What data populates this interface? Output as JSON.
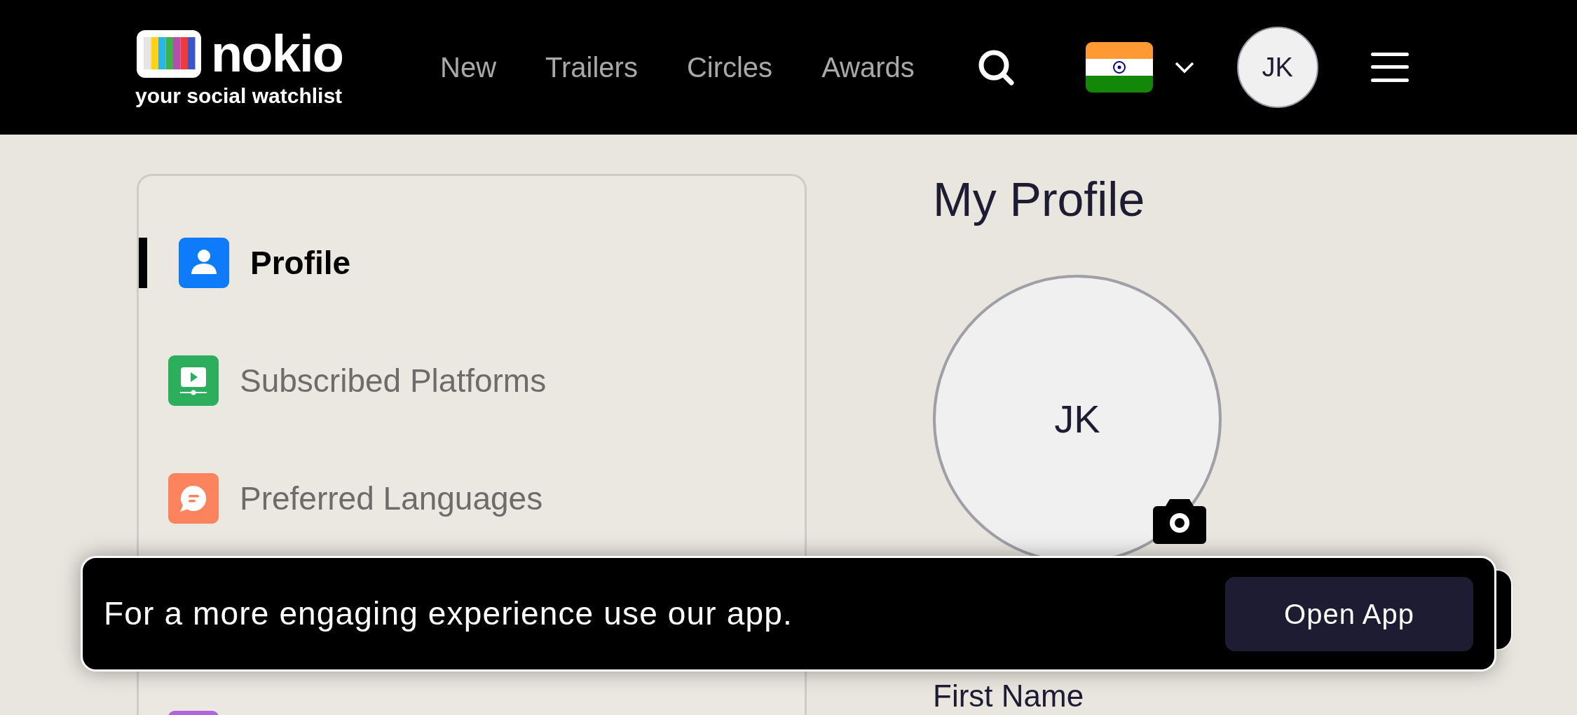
{
  "header": {
    "logo": {
      "name": "nokio",
      "tagline": "your social watchlist"
    },
    "nav": [
      {
        "label": "New"
      },
      {
        "label": "Trailers"
      },
      {
        "label": "Circles"
      },
      {
        "label": "Awards"
      }
    ],
    "avatar": {
      "initials": "JK"
    }
  },
  "sidebar": {
    "items": [
      {
        "kind": "person",
        "label": "Profile",
        "selected": true,
        "color": "#0d7bfa"
      },
      {
        "kind": "screen",
        "label": "Subscribed Platforms",
        "selected": false,
        "color": "#2cae5c"
      },
      {
        "kind": "chat",
        "label": "Preferred Languages",
        "selected": false,
        "color": "#fb845f"
      },
      {
        "kind": "blank",
        "color": "#b463dc"
      }
    ]
  },
  "profile": {
    "title": "My Profile",
    "avatar_initials": "JK",
    "first_name_label": "First Name"
  },
  "banner": {
    "message": "For a more engaging experience use our app.",
    "button": "Open App"
  }
}
